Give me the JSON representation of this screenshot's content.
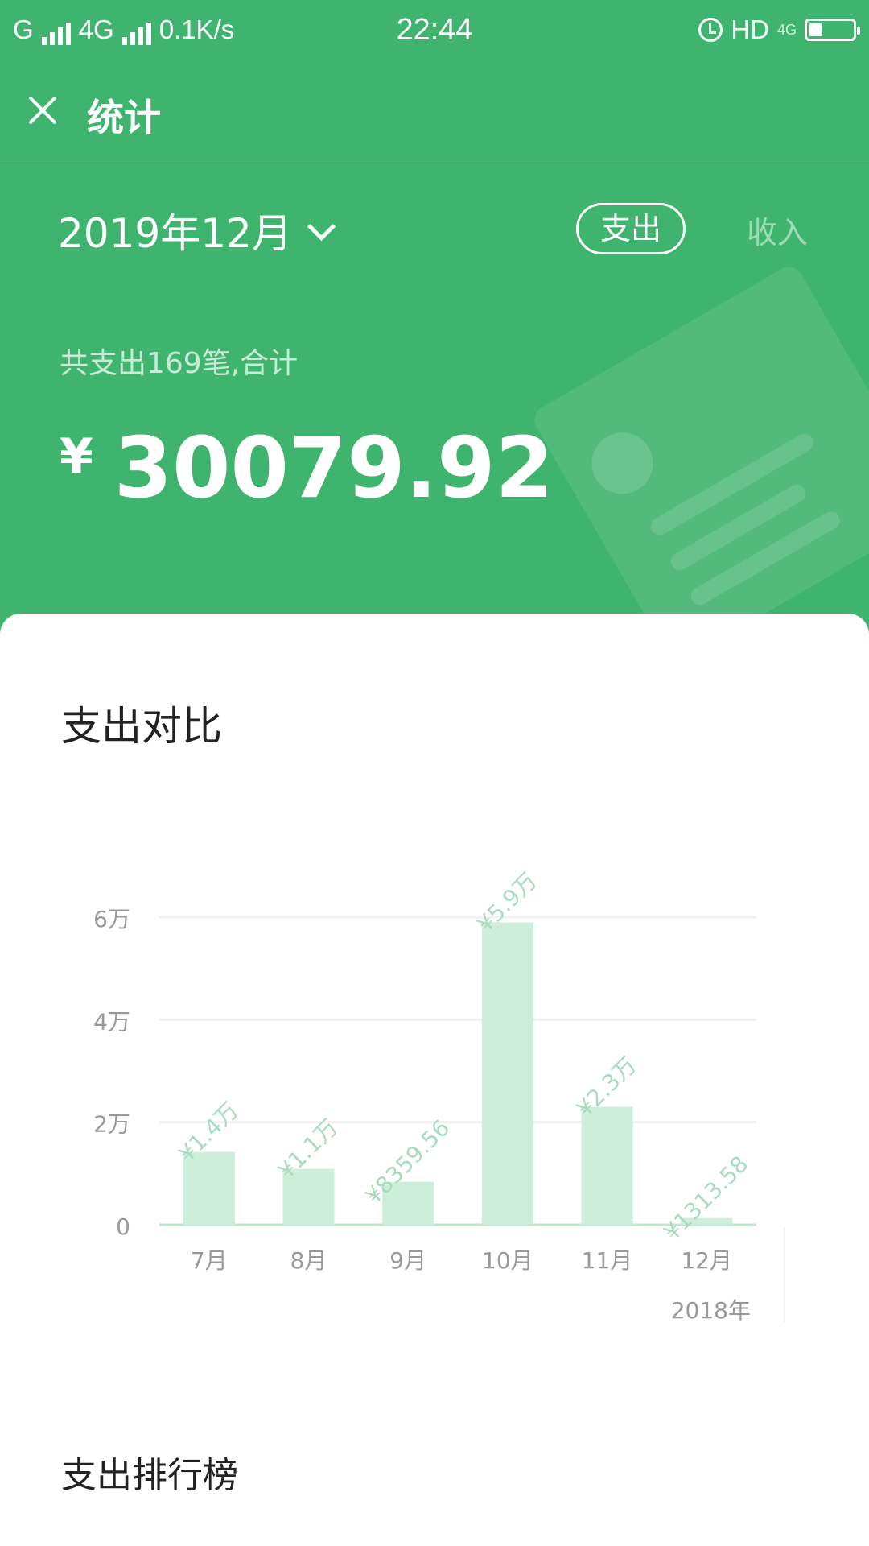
{
  "status_bar": {
    "carrier": "G",
    "network": "4G",
    "speed": "0.1K/s",
    "time": "22:44",
    "hd": "HD",
    "net_right": "4G"
  },
  "toolbar": {
    "title": "统计"
  },
  "header": {
    "month": "2019年12月",
    "tab_expense": "支出",
    "tab_income": "收入",
    "summary": "共支出169笔,合计",
    "currency": "¥",
    "total": "30079.92"
  },
  "card": {
    "title": "支出对比",
    "ranking_title": "支出排行榜"
  },
  "chart_data": {
    "type": "bar",
    "categories": [
      "7月",
      "8月",
      "9月",
      "10月",
      "11月",
      "12月"
    ],
    "values": [
      14200,
      10900,
      8359.56,
      59000,
      23000,
      1313.58
    ],
    "data_labels": [
      "¥1.4万",
      "¥1.1万",
      "¥8359.56",
      "¥5.9万",
      "¥2.3万",
      "¥1313.58"
    ],
    "y_ticks": [
      0,
      20000,
      40000,
      60000
    ],
    "y_tick_labels": [
      "0",
      "2万",
      "4万",
      "6万"
    ],
    "ylim": [
      0,
      60000
    ],
    "x_note": "2018年",
    "grid": true,
    "colors": {
      "bar": "#cdeedb",
      "label": "#a9dcbe",
      "axis": "#bfe6cf"
    }
  }
}
